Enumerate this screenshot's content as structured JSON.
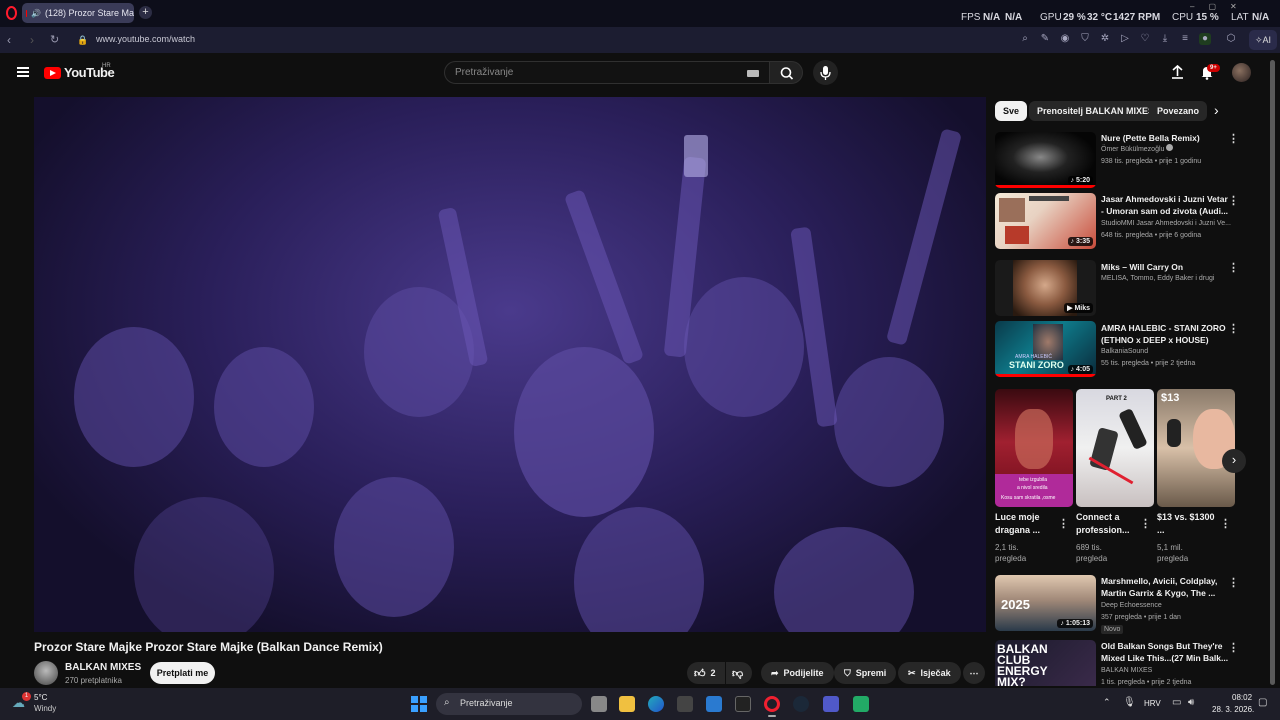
{
  "browser": {
    "tab_title": "(128) Prozor Stare Ma",
    "url": "www.youtube.com/watch",
    "stats": {
      "fps_label": "FPS",
      "fps_val": "N/A",
      "fps_val2": "N/A",
      "gpu_label": "GPU",
      "gpu_pct": "29 %",
      "gpu_temp": "32 °C",
      "gpu_rpm": "1427 RPM",
      "cpu_label": "CPU",
      "cpu_pct": "15 %",
      "lat_label": "LAT",
      "lat_val": "N/A"
    },
    "ai_label": "AI"
  },
  "youtube": {
    "logo_text": "YouTube",
    "region": "HR",
    "search_placeholder": "Pretraživanje",
    "notif_count": "9+"
  },
  "video": {
    "title": "Prozor Stare Majke Prozor Stare Majke (Balkan Dance Remix)",
    "channel": "BALKAN MIXES",
    "subscribers": "270 pretplatnika",
    "subscribe_label": "Pretplati me",
    "likes": "2",
    "share_label": "Podijelite",
    "save_label": "Spremi",
    "clip_label": "Isječak"
  },
  "chips": [
    "Sve",
    "Prenositelj BALKAN MIXES",
    "Povezano"
  ],
  "recommendations_top": [
    {
      "title": "Nure (Pette Bella Remix)",
      "channel": "Ömer Bükülmezoğlu",
      "meta": "938 tis. pregleda • prije 1 godinu",
      "duration": "5:20"
    },
    {
      "title": "Jasar Ahmedovski i Juzni Vetar - Umoran sam od zivota (Audi...",
      "channel": "StudioMMI Jasar Ahmedovski i Juzni Ve...",
      "meta": "648 tis. pregleda • prije 6 godina",
      "duration": "3:35"
    },
    {
      "title": "Miks – Will Carry On",
      "channel": "MELISA, Tommo, Eddy Baker i drugi",
      "meta": "",
      "duration": "Miks"
    },
    {
      "title": "AMRA HALEBIC - STANI ZORO (ETHNO x DEEP x HOUSE)",
      "channel": "BalkaniaSound",
      "meta": "55 tis. pregleda • prije 2 tjedna",
      "duration": "4:05"
    }
  ],
  "thumb_texts": {
    "amra": "AMRA HALEBIĆ",
    "stani": "STANI ZORO",
    "part2": "PART 2",
    "price": "$13",
    "luce1": "tebe izgubila",
    "luce2": "a nivol sredila",
    "luce3": "Kosu sam skratila ,osme",
    "year": "2025",
    "balkan1": "BALKAN",
    "balkan2": "CLUB",
    "balkan3": "ENERGY",
    "balkan4": "MIX?"
  },
  "shorts": [
    {
      "title": "Luce moje dragana ...",
      "views1": "2,1 tis.",
      "views2": "pregleda"
    },
    {
      "title": "Connect a profession...",
      "views1": "689 tis.",
      "views2": "pregleda"
    },
    {
      "title": "$13 vs. $1300 ...",
      "views1": "5,1 mil.",
      "views2": "pregleda"
    }
  ],
  "recommendations_bottom": [
    {
      "title": "Marshmello, Avicii, Coldplay, Martin Garrix & Kygo, The ...",
      "channel": "Deep Echoessence",
      "meta": "357 pregleda • prije 1 dan",
      "badge": "Novo",
      "duration": "1:05:13"
    },
    {
      "title": "Old Balkan Songs But They're Mixed Like This...(27 Min Balk...",
      "channel": "BALKAN MIXES",
      "meta": "1 tis. pregleda • prije 2 tjedna",
      "duration": ""
    }
  ],
  "taskbar": {
    "weather_temp": "5°C",
    "weather_desc": "Windy",
    "weather_badge": "1",
    "search_placeholder": "Pretraživanje",
    "lang": "HRV",
    "time": "08:02",
    "date": "28. 3. 2026."
  }
}
